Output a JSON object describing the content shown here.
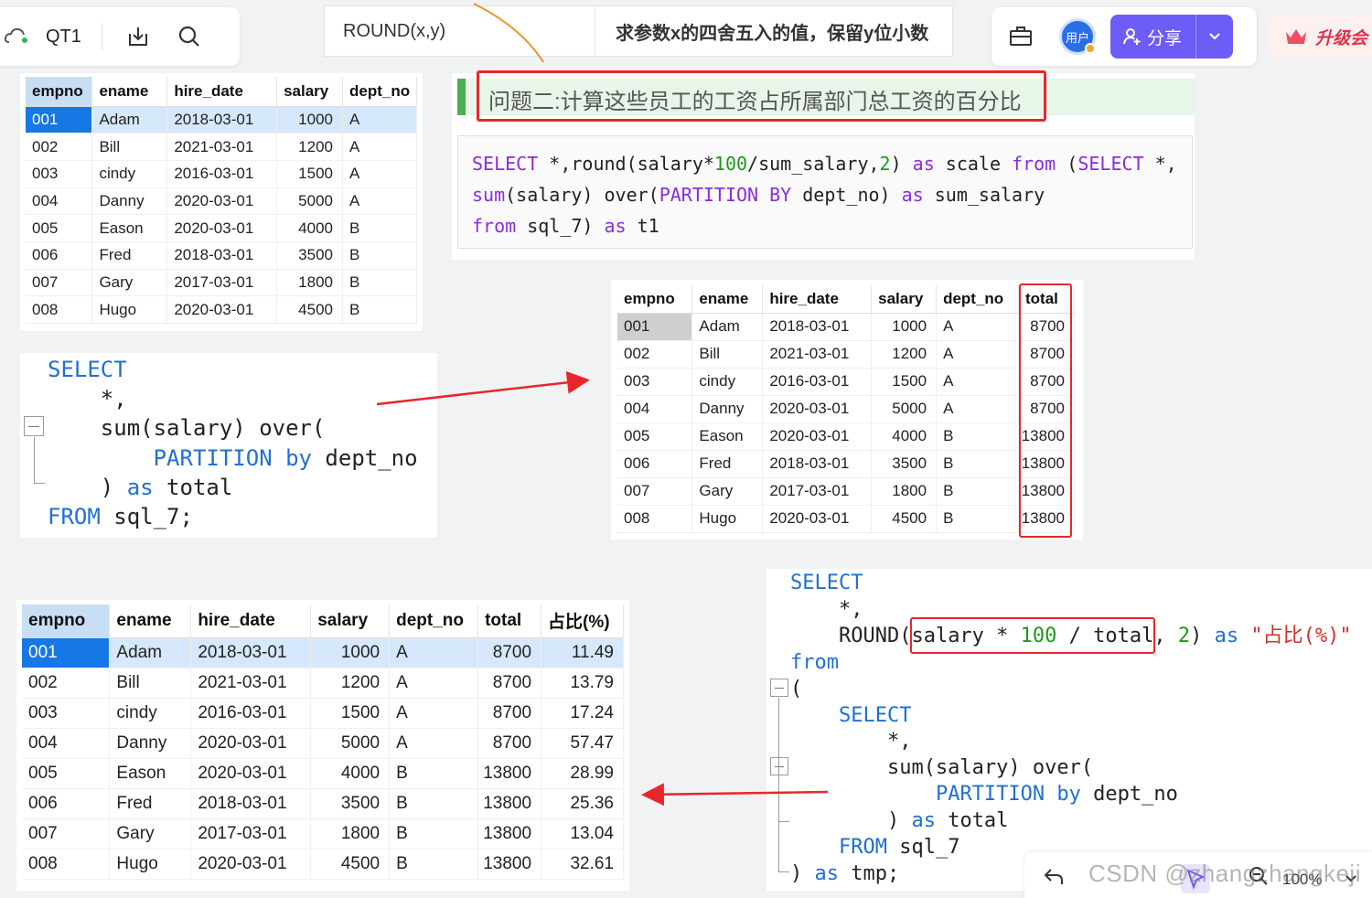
{
  "toolbar": {
    "doc_title": "QT1",
    "formula_name": "ROUND(x,y)",
    "formula_desc": "求参数x的四舍五入的值，保留y位小数",
    "avatar_label": "用户",
    "share_label": "分享",
    "upgrade_label": "升级会"
  },
  "question": {
    "title": "问题二:计算这些员工的工资占所属部门总工资的百分比",
    "accent_color": "#e8262a",
    "bar_color": "#4caf50"
  },
  "table1": {
    "columns": [
      "empno",
      "ename",
      "hire_date",
      "salary",
      "dept_no"
    ],
    "rows": [
      [
        "001",
        "Adam",
        "2018-03-01",
        "1000",
        "A"
      ],
      [
        "002",
        "Bill",
        "2021-03-01",
        "1200",
        "A"
      ],
      [
        "003",
        "cindy",
        "2016-03-01",
        "1500",
        "A"
      ],
      [
        "004",
        "Danny",
        "2020-03-01",
        "5000",
        "A"
      ],
      [
        "005",
        "Eason",
        "2020-03-01",
        "4000",
        "B"
      ],
      [
        "006",
        "Fred",
        "2018-03-01",
        "3500",
        "B"
      ],
      [
        "007",
        "Gary",
        "2017-03-01",
        "1800",
        "B"
      ],
      [
        "008",
        "Hugo",
        "2020-03-01",
        "4500",
        "B"
      ]
    ]
  },
  "table2": {
    "columns": [
      "empno",
      "ename",
      "hire_date",
      "salary",
      "dept_no",
      "total"
    ],
    "rows": [
      [
        "001",
        "Adam",
        "2018-03-01",
        "1000",
        "A",
        "8700"
      ],
      [
        "002",
        "Bill",
        "2021-03-01",
        "1200",
        "A",
        "8700"
      ],
      [
        "003",
        "cindy",
        "2016-03-01",
        "1500",
        "A",
        "8700"
      ],
      [
        "004",
        "Danny",
        "2020-03-01",
        "5000",
        "A",
        "8700"
      ],
      [
        "005",
        "Eason",
        "2020-03-01",
        "4000",
        "B",
        "13800"
      ],
      [
        "006",
        "Fred",
        "2018-03-01",
        "3500",
        "B",
        "13800"
      ],
      [
        "007",
        "Gary",
        "2017-03-01",
        "1800",
        "B",
        "13800"
      ],
      [
        "008",
        "Hugo",
        "2020-03-01",
        "4500",
        "B",
        "13800"
      ]
    ]
  },
  "table3": {
    "columns": [
      "empno",
      "ename",
      "hire_date",
      "salary",
      "dept_no",
      "total",
      "占比(%)"
    ],
    "rows": [
      [
        "001",
        "Adam",
        "2018-03-01",
        "1000",
        "A",
        "8700",
        "11.49"
      ],
      [
        "002",
        "Bill",
        "2021-03-01",
        "1200",
        "A",
        "8700",
        "13.79"
      ],
      [
        "003",
        "cindy",
        "2016-03-01",
        "1500",
        "A",
        "8700",
        "17.24"
      ],
      [
        "004",
        "Danny",
        "2020-03-01",
        "5000",
        "A",
        "8700",
        "57.47"
      ],
      [
        "005",
        "Eason",
        "2020-03-01",
        "4000",
        "B",
        "13800",
        "28.99"
      ],
      [
        "006",
        "Fred",
        "2018-03-01",
        "3500",
        "B",
        "13800",
        "25.36"
      ],
      [
        "007",
        "Gary",
        "2017-03-01",
        "1800",
        "B",
        "13800",
        "13.04"
      ],
      [
        "008",
        "Hugo",
        "2020-03-01",
        "4500",
        "B",
        "13800",
        "32.61"
      ]
    ]
  },
  "code1": {
    "l1a": "SELECT",
    "l1b": " *,round(salary*",
    "l1c": "100",
    "l1d": "/sum_salary,",
    "l1e": "2",
    "l1f": ") ",
    "l1g": "as",
    "l1h": " scale ",
    "l1i": "from",
    "l1j": " (",
    "l1k": "SELECT",
    "l1l": " *,",
    "l2a": "sum",
    "l2b": "(salary) over(",
    "l2c": "PARTITION BY",
    "l2d": " dept_no) ",
    "l2e": "as",
    "l2f": " sum_salary",
    "l3a": "from",
    "l3b": " sql_7) ",
    "l3c": "as",
    "l3d": " t1"
  },
  "code2": {
    "l1": "SELECT",
    "l2": "    *,",
    "l3": "    sum(salary) over(",
    "l4a": "        ",
    "l4b": "PARTITION by",
    "l4c": " dept_no",
    "l5a": "    ) ",
    "l5b": "as",
    "l5c": " total",
    "l6a": "FROM",
    "l6b": " sql_7;"
  },
  "code3": {
    "l1": "SELECT",
    "l2": "    *,",
    "l3a": "    ROUND(",
    "l3b": "salary * ",
    "l3c": "100",
    "l3d": " / total",
    "l3e": ", ",
    "l3f": "2",
    "l3g": ") ",
    "l3h": "as",
    "l3i": " ",
    "l3j": "\"占比(%)\"",
    "l4": "from",
    "l5": "(",
    "l6": "    SELECT",
    "l7": "        *,",
    "l8": "        sum(salary) over(",
    "l9a": "            ",
    "l9b": "PARTITION by",
    "l9c": " dept_no",
    "l10a": "        ) ",
    "l10b": "as",
    "l10c": " total",
    "l11a": "    ",
    "l11b": "FROM",
    "l11c": " sql_7",
    "l12a": ") ",
    "l12b": "as",
    "l12c": " tmp;"
  },
  "footer": {
    "watermark": "CSDN @zhangzhangkeji",
    "zoom": "100%"
  }
}
